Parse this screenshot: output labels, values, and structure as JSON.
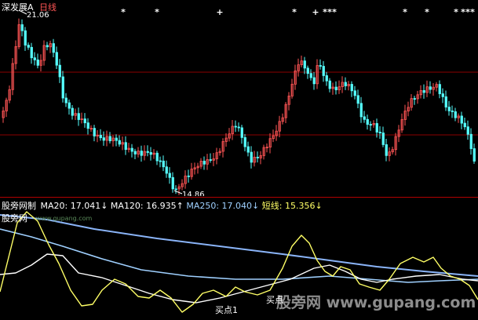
{
  "header": {
    "stock_name": "深发展A",
    "period": "日线"
  },
  "price_panel": {
    "high_label": "21.06",
    "low_label": "14.86",
    "markers": [
      "*",
      "*",
      "+",
      "*",
      "+",
      "*",
      "*",
      "*",
      "*",
      "*",
      "*",
      "*",
      "*",
      "*"
    ]
  },
  "indicator_bar": {
    "name": "股旁网制",
    "ma20": "MA20: 17.041↓",
    "ma120": "MA120: 16.935↑",
    "ma250": "MA250: 17.040↓",
    "short": "短线: 15.356↓"
  },
  "lower_panel": {
    "logo_text": "股旁网",
    "site_small": "www.gupang.com",
    "buy_label_1": "买点1",
    "buy_label_2": "买点",
    "watermark": "股旁网 www.gupang.com"
  },
  "colors": {
    "background": "#000000",
    "up": "#ff5555",
    "down": "#55ffff",
    "grid": "#8b0000",
    "ma20": "#ffffff",
    "ma120": "#9fd0ff",
    "ma250": "#8ab4f8",
    "short": "#ffff66",
    "label": "#ffffff"
  }
}
